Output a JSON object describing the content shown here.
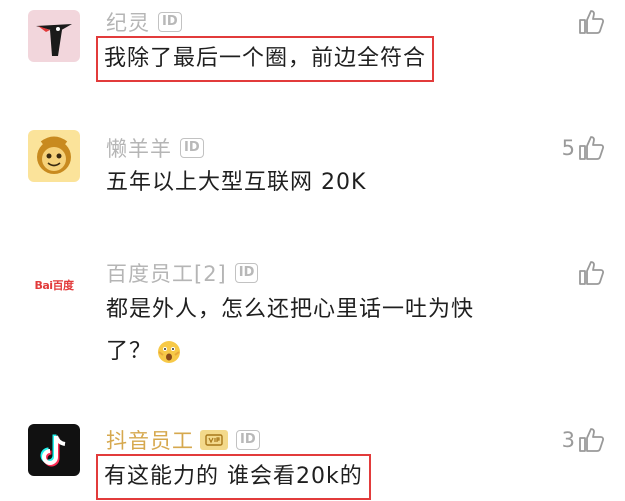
{
  "comments": [
    {
      "name": "纪灵",
      "text": "我除了最后一个圈，前边全符合",
      "likes": ""
    },
    {
      "name": "懒羊羊",
      "text": "五年以上大型互联网 20K",
      "likes": "5"
    },
    {
      "name": "百度员工[2]",
      "text_line1": "都是外人，怎么还把心里话一吐为快",
      "text_line2": "了？",
      "likes": "",
      "avatar_text": "Bai百度"
    },
    {
      "name": "抖音员工",
      "text": "有这能力的 谁会看20k的",
      "likes": "3"
    }
  ],
  "id_badge": "ID",
  "colors": {
    "highlight_box": "#e23b3b",
    "muted": "#b5b5b5",
    "gold_name": "#d6a84e"
  }
}
